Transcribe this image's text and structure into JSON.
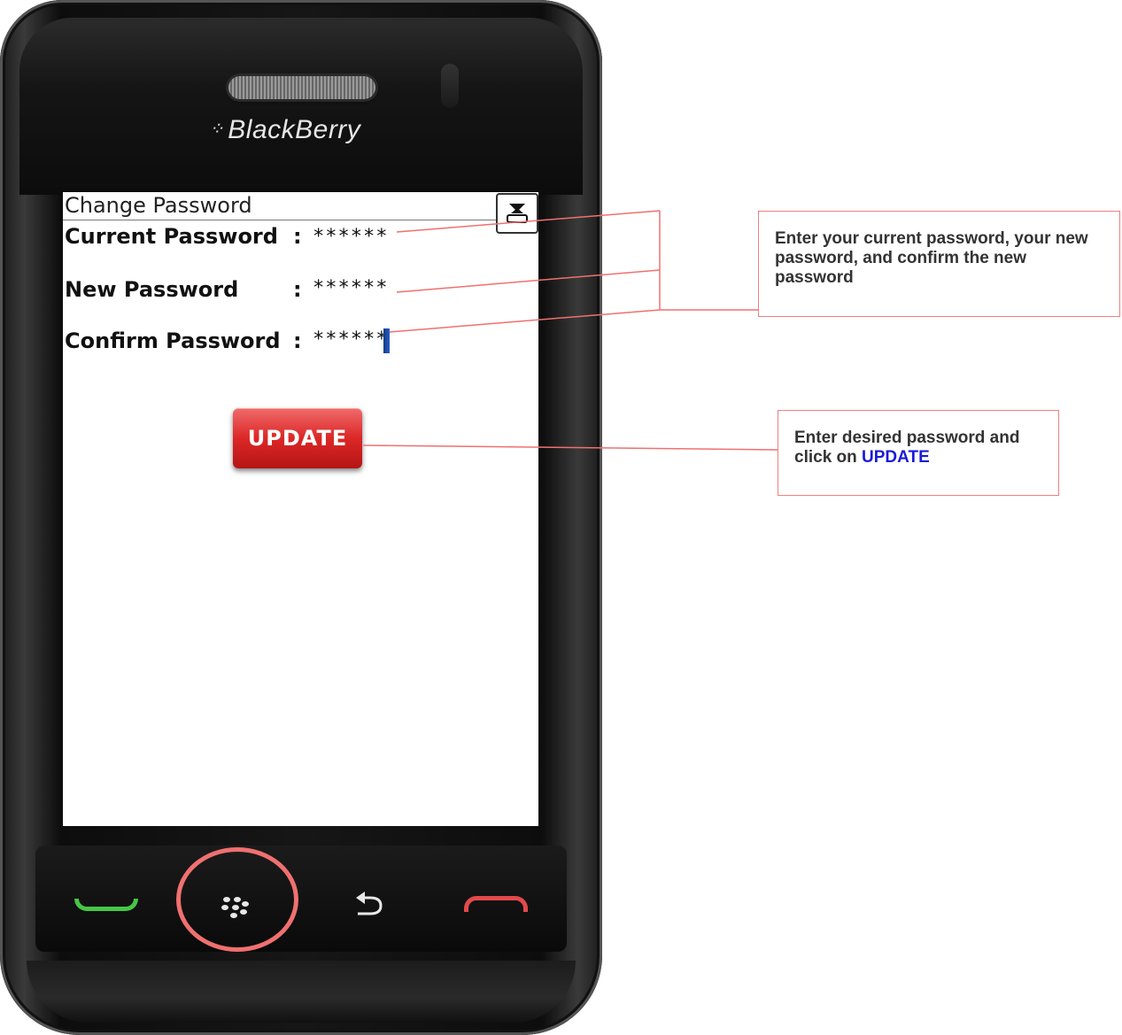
{
  "device": {
    "brand": "BlackBerry",
    "brand_logo_icon": "blackberry-logo-icon"
  },
  "screen": {
    "title": "Change Password",
    "keyboard_icon": "keyboard-toggle-icon",
    "fields": {
      "current": {
        "label": "Current Password",
        "colon": ":",
        "value": "******"
      },
      "new": {
        "label": "New Password",
        "colon": ":",
        "value": "******"
      },
      "confirm": {
        "label": "Confirm Password",
        "colon": ":",
        "value": "******"
      }
    },
    "update_button": "UPDATE"
  },
  "keys": {
    "call": "call-key-icon",
    "menu": "blackberry-menu-icon",
    "back": "back-arrow-icon",
    "end": "end-call-icon"
  },
  "callouts": {
    "passwords": "Enter your current password, your new password, and confirm the new password",
    "update_prefix": "Enter desired password and click on ",
    "update_highlight": "UPDATE"
  },
  "colors": {
    "callout_border": "#f08080",
    "button_red": "#dc2727",
    "accent_blue": "#1a1ad8",
    "call_green": "#45c745",
    "end_red": "#e24a4a"
  }
}
